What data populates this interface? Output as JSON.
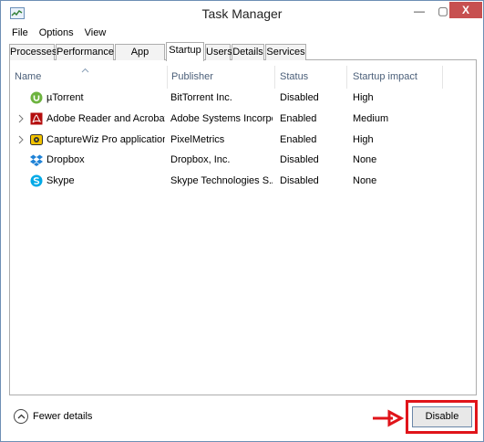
{
  "window": {
    "title": "Task Manager",
    "minimize_icon": "minimize-icon",
    "maximize_icon": "maximize-icon",
    "close_label": "X"
  },
  "menu": [
    "File",
    "Options",
    "View"
  ],
  "tabs": [
    {
      "label": "Processes",
      "active": false
    },
    {
      "label": "Performance",
      "active": false
    },
    {
      "label": "App history",
      "active": false
    },
    {
      "label": "Startup",
      "active": true
    },
    {
      "label": "Users",
      "active": false
    },
    {
      "label": "Details",
      "active": false
    },
    {
      "label": "Services",
      "active": false
    }
  ],
  "table": {
    "columns": [
      "Name",
      "Publisher",
      "Status",
      "Startup impact"
    ],
    "sorted_column": "Name",
    "rows": [
      {
        "name": "µTorrent",
        "publisher": "BitTorrent Inc.",
        "status": "Disabled",
        "impact": "High",
        "icon": "utorrent-icon",
        "expandable": false
      },
      {
        "name": "Adobe Reader and Acrobat ...",
        "publisher": "Adobe Systems Incorpor...",
        "status": "Enabled",
        "impact": "Medium",
        "icon": "adobe-reader-icon",
        "expandable": true
      },
      {
        "name": "CaptureWiz Pro application ...",
        "publisher": "PixelMetrics",
        "status": "Enabled",
        "impact": "High",
        "icon": "capturewiz-icon",
        "expandable": true
      },
      {
        "name": "Dropbox",
        "publisher": "Dropbox, Inc.",
        "status": "Disabled",
        "impact": "None",
        "icon": "dropbox-icon",
        "expandable": false
      },
      {
        "name": "Skype",
        "publisher": "Skype Technologies S.A.",
        "status": "Disabled",
        "impact": "None",
        "icon": "skype-icon",
        "expandable": false
      }
    ]
  },
  "footer": {
    "fewer_details_label": "Fewer details",
    "disable_button_label": "Disable"
  },
  "colors": {
    "highlight": "#e0141a",
    "header_text": "#4c607a",
    "close_button": "#c75050"
  }
}
